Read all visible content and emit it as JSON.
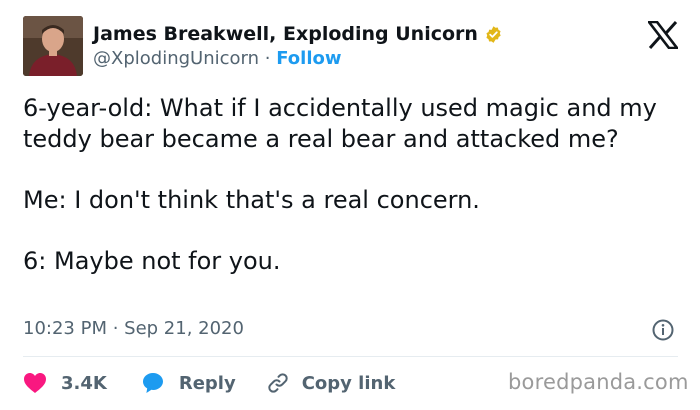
{
  "author": {
    "display_name": "James Breakwell, Exploding Unicorn",
    "handle": "@XplodingUnicorn",
    "separator": "·",
    "follow_label": "Follow",
    "verified": true
  },
  "tweet": {
    "lines": [
      "6-year-old: What if I accidentally used magic and my teddy bear became a real bear and attacked me?",
      "Me: I don't think that's a real concern.",
      "6: Maybe not for you."
    ],
    "timestamp": "10:23 PM · Sep 21, 2020"
  },
  "actions": {
    "likes": "3.4K",
    "reply_label": "Reply",
    "copy_link_label": "Copy link"
  },
  "watermark": "boredpanda.com",
  "colors": {
    "accent": "#1d9bf0",
    "heart": "#f91880",
    "muted": "#536471",
    "verified_gold": "#e2b719"
  },
  "icons": {
    "brand": "x-logo",
    "badge": "verified-badge-icon",
    "info": "info-icon",
    "like": "heart-icon",
    "reply": "speech-bubble-icon",
    "copy": "link-icon"
  }
}
